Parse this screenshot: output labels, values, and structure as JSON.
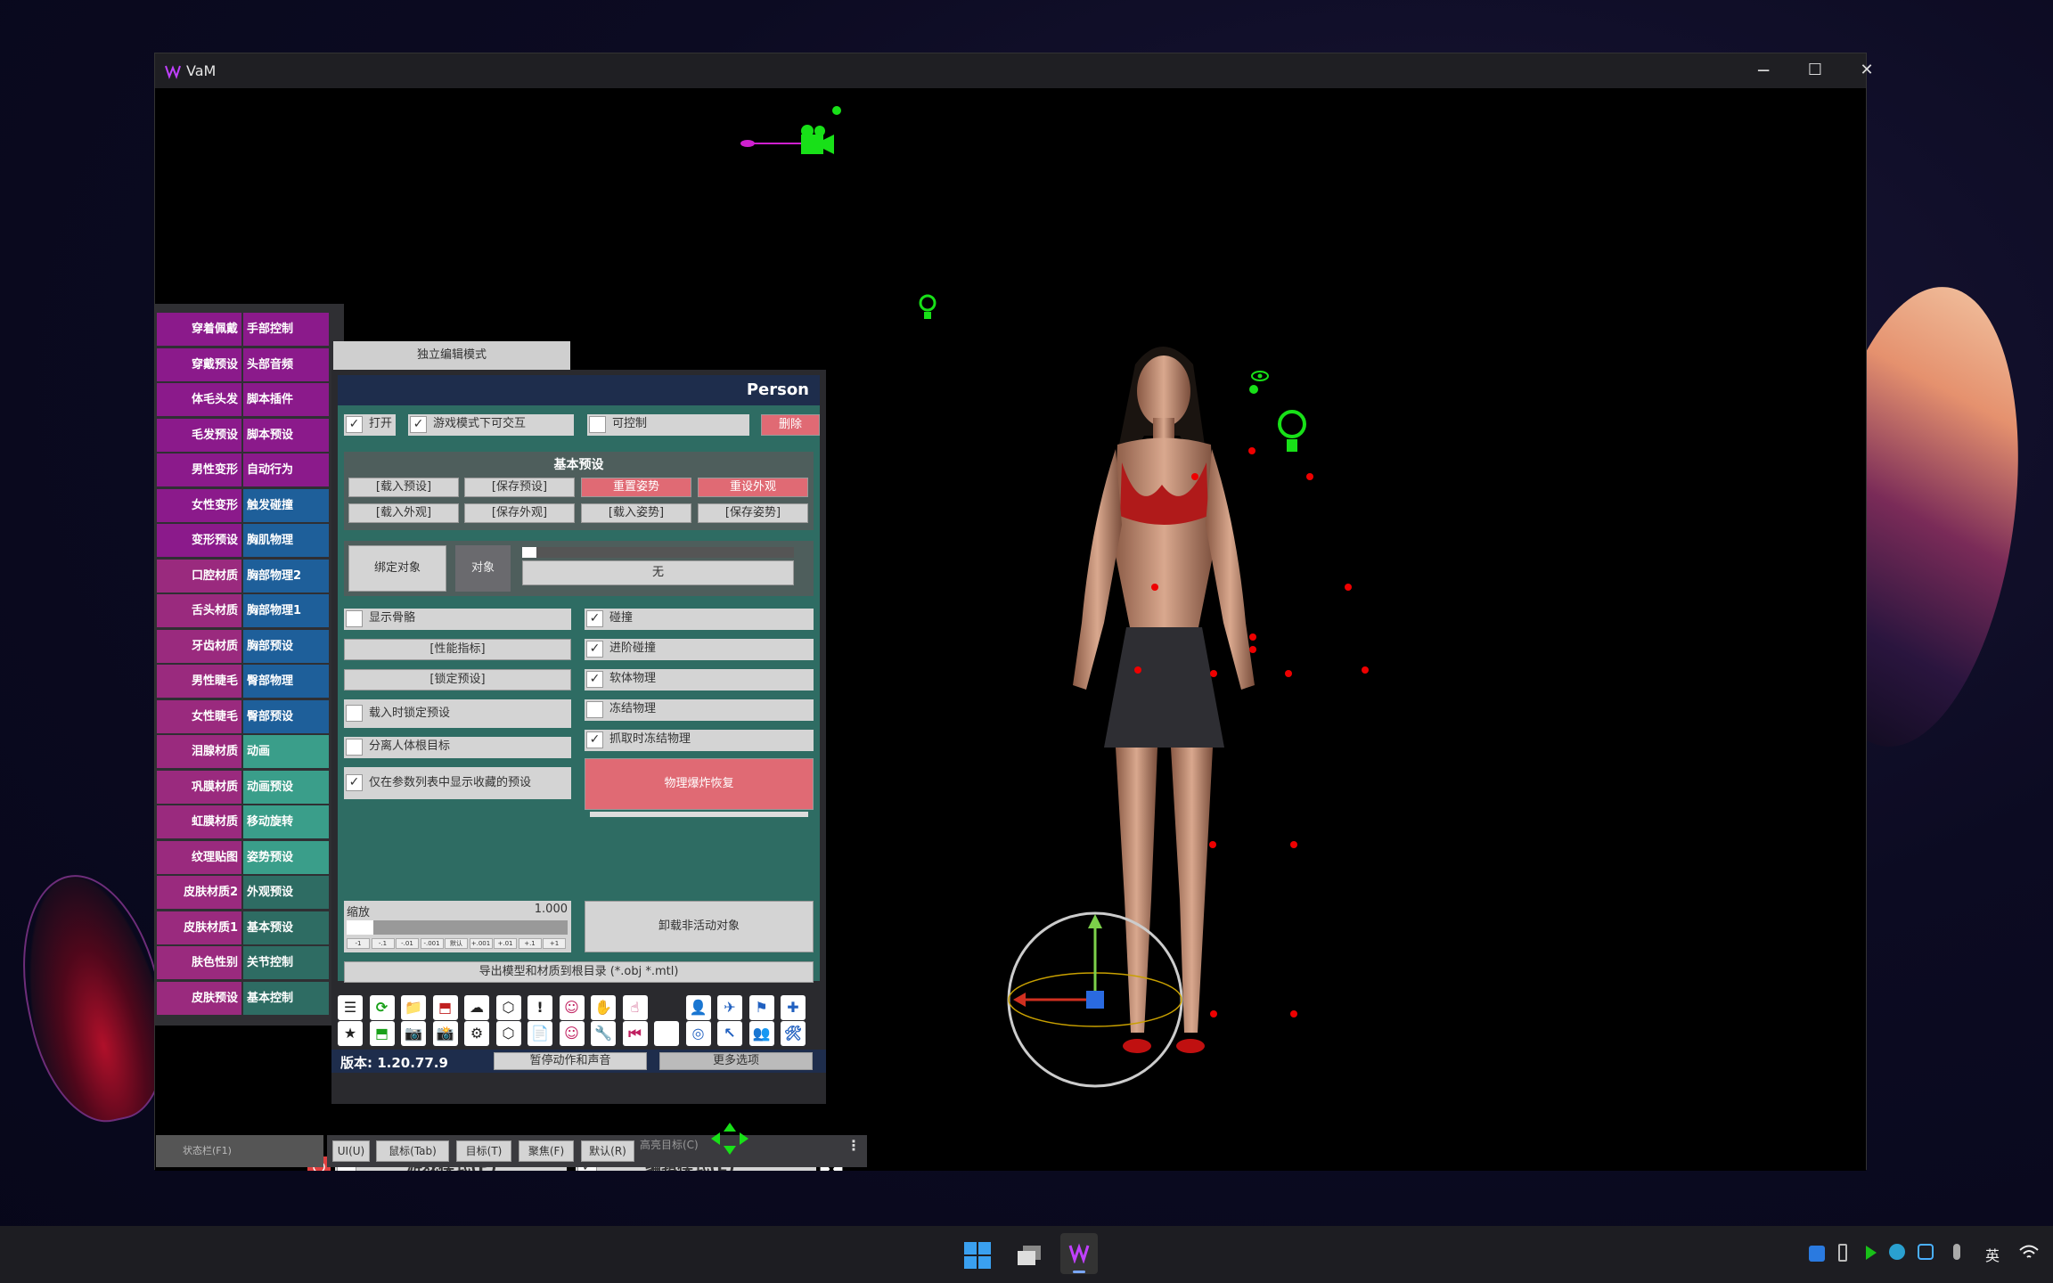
{
  "window": {
    "title": "VaM",
    "minimize": "─",
    "maximize": "☐",
    "close": "✕"
  },
  "left_tabs": [
    {
      "a": "穿着佩戴",
      "b": "手部控制",
      "ca": "#8b1a8b",
      "cb": "#8b1a8b"
    },
    {
      "a": "穿戴预设",
      "b": "头部音频",
      "ca": "#8b1a8b",
      "cb": "#8b1a8b"
    },
    {
      "a": "体毛头发",
      "b": "脚本插件",
      "ca": "#8b1a8b",
      "cb": "#8b1a8b"
    },
    {
      "a": "毛发预设",
      "b": "脚本预设",
      "ca": "#8b1a8b",
      "cb": "#8b1a8b"
    },
    {
      "a": "男性变形",
      "b": "自动行为",
      "ca": "#8b1a8b",
      "cb": "#8b1a8b"
    },
    {
      "a": "女性变形",
      "b": "触发碰撞",
      "ca": "#8b1a8b",
      "cb": "#1e5f9a"
    },
    {
      "a": "变形预设",
      "b": "胸肌物理",
      "ca": "#8b1a8b",
      "cb": "#1e5f9a"
    },
    {
      "a": "口腔材质",
      "b": "胸部物理2",
      "ca": "#9a2a7e",
      "cb": "#1e5f9a"
    },
    {
      "a": "舌头材质",
      "b": "胸部物理1",
      "ca": "#9a2a7e",
      "cb": "#1e5f9a"
    },
    {
      "a": "牙齿材质",
      "b": "胸部预设",
      "ca": "#9a2a7e",
      "cb": "#1e5f9a"
    },
    {
      "a": "男性睫毛",
      "b": "臀部物理",
      "ca": "#9a2a7e",
      "cb": "#1e5f9a"
    },
    {
      "a": "女性睫毛",
      "b": "臀部预设",
      "ca": "#9a2a7e",
      "cb": "#1e5f9a"
    },
    {
      "a": "泪腺材质",
      "b": "动画",
      "ca": "#9a2a7e",
      "cb": "#3a9e8a"
    },
    {
      "a": "巩膜材质",
      "b": "动画预设",
      "ca": "#9a2a7e",
      "cb": "#3a9e8a"
    },
    {
      "a": "虹膜材质",
      "b": "移动旋转",
      "ca": "#9a2a7e",
      "cb": "#3a9e8a"
    },
    {
      "a": "纹理贴图",
      "b": "姿势预设",
      "ca": "#9a2a7e",
      "cb": "#3a9e8a"
    },
    {
      "a": "皮肤材质2",
      "b": "外观预设",
      "ca": "#9a2a7e",
      "cb": "#2e6c63"
    },
    {
      "a": "皮肤材质1",
      "b": "基本预设",
      "ca": "#9a2a7e",
      "cb": "#2e6c63"
    },
    {
      "a": "肤色性别",
      "b": "关节控制",
      "ca": "#9a2a7e",
      "cb": "#2e6c63"
    },
    {
      "a": "皮肤预设",
      "b": "基本控制",
      "ca": "#9a2a7e",
      "cb": "#2e6c63"
    }
  ],
  "panel": {
    "independent_edit": "独立编辑模式",
    "title": "Person",
    "on": "打开",
    "interact_game": "游戏模式下可交互",
    "controllable": "可控制",
    "delete": "删除",
    "basic_presets": "基本预设",
    "load_preset": "[载入预设]",
    "save_preset": "[保存预设]",
    "reset_pose": "重置姿势",
    "reset_look": "重设外观",
    "load_look": "[载入外观]",
    "save_look": "[保存外观]",
    "load_pose": "[载入姿势]",
    "save_pose": "[保存姿势]",
    "bind_object": "绑定对象",
    "object": "对象",
    "none": "无",
    "show_bones": "显示骨骼",
    "perf": "[性能指标]",
    "lock_preset": "[锁定预设]",
    "lock_on_load": "载入时锁定预设",
    "detach_root": "分离人体根目标",
    "favorites_only": "仅在参数列表中显示收藏的预设",
    "collision": "碰撞",
    "adv_collision": "进阶碰撞",
    "soft_physics": "软体物理",
    "freeze_physics": "冻结物理",
    "freeze_grab": "抓取时冻结物理",
    "physics_recover": "物理爆炸恢复",
    "scale": "缩放",
    "scale_val": "1.000",
    "scale_ticks": [
      "-1",
      "-.1",
      "-.01",
      "-.001",
      "默认",
      "+.001",
      "+.01",
      "+.1",
      "+1"
    ],
    "unload_inactive": "卸载非活动对象",
    "export": "导出模型和材质到根目录 (*.obj *.mtl)"
  },
  "toolbar": {
    "version": "版本: 1.20.77.9",
    "pause": "暂停动作和声音",
    "more": "更多选项",
    "game_mode": "游戏模式(P)",
    "edit_mode": "编辑模式(E)",
    "close_x": "X",
    "row1": [
      "☰",
      "⟳",
      "📁",
      "⬒",
      "☁",
      "⬡",
      "!",
      "☺",
      "✋",
      "☝",
      "",
      "👤",
      "✈",
      "⚑",
      "✚"
    ],
    "row2": [
      "★",
      "⬒",
      "📷",
      "📸",
      "⚙",
      "⬡",
      "📄",
      "☺",
      "🔧",
      "⏮",
      "▶",
      "◎",
      "↖",
      "👥",
      "🛠"
    ]
  },
  "bottom": {
    "status": "状态栏(F1)",
    "ui": "UI(U)",
    "mouse": "鼠标(Tab)",
    "target": "目标(T)",
    "focus": "聚焦(F)",
    "default": "默认(R)",
    "highlight": "高亮目标(C)"
  },
  "taskbar": {
    "lang": "英"
  }
}
